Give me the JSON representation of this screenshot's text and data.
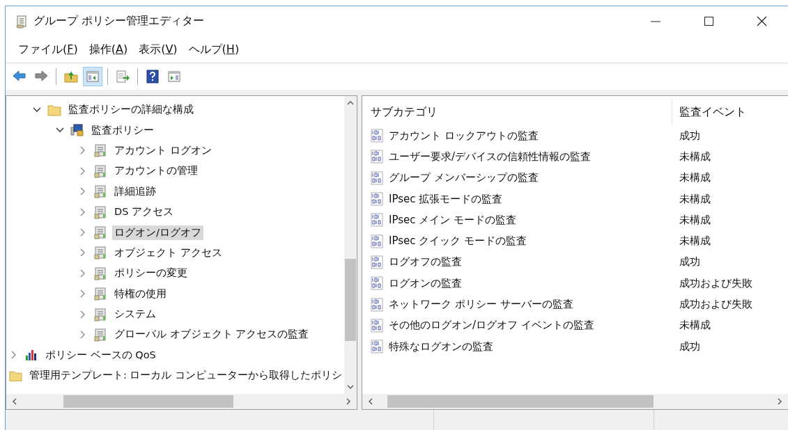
{
  "window": {
    "title": "グループ ポリシー管理エディター"
  },
  "menu": [
    {
      "label": "ファイル(",
      "access_key": "F",
      "label_end": ")"
    },
    {
      "label": "操作(",
      "access_key": "A",
      "label_end": ")"
    },
    {
      "label": "表示(",
      "access_key": "V",
      "label_end": ")"
    },
    {
      "label": "ヘルプ(",
      "access_key": "H",
      "label_end": ")"
    }
  ],
  "toolbar": [
    {
      "kind": "back",
      "pressed": false
    },
    {
      "kind": "forward",
      "pressed": false
    },
    {
      "kind": "separator"
    },
    {
      "kind": "up",
      "pressed": false
    },
    {
      "kind": "tree-toggle",
      "pressed": true
    },
    {
      "kind": "separator"
    },
    {
      "kind": "export",
      "pressed": false
    },
    {
      "kind": "separator"
    },
    {
      "kind": "help",
      "pressed": false
    },
    {
      "kind": "action-pane",
      "pressed": false
    }
  ],
  "tree": {
    "items": [
      {
        "kind": "offscreen-parent",
        "children": [
          {
            "kind": "folder",
            "label": "監査ポリシーの詳細な構成",
            "expanded": true,
            "selected": false,
            "children": [
              {
                "kind": "policy",
                "label": "監査ポリシー",
                "expanded": true,
                "selected": false,
                "children": [
                  {
                    "kind": "category",
                    "label": "アカウント ログオン",
                    "expanded": false,
                    "selected": false
                  },
                  {
                    "kind": "category",
                    "label": "アカウントの管理",
                    "expanded": false,
                    "selected": false
                  },
                  {
                    "kind": "category",
                    "label": "詳細追跡",
                    "expanded": false,
                    "selected": false
                  },
                  {
                    "kind": "category",
                    "label": "DS アクセス",
                    "expanded": false,
                    "selected": false
                  },
                  {
                    "kind": "category",
                    "label": "ログオン/ログオフ",
                    "expanded": false,
                    "selected": true
                  },
                  {
                    "kind": "category",
                    "label": "オブジェクト アクセス",
                    "expanded": false,
                    "selected": false
                  },
                  {
                    "kind": "category",
                    "label": "ポリシーの変更",
                    "expanded": false,
                    "selected": false
                  },
                  {
                    "kind": "category",
                    "label": "特権の使用",
                    "expanded": false,
                    "selected": false
                  },
                  {
                    "kind": "category",
                    "label": "システム",
                    "expanded": false,
                    "selected": false
                  },
                  {
                    "kind": "category",
                    "label": "グローバル オブジェクト アクセスの監査",
                    "expanded": false,
                    "selected": false
                  }
                ]
              }
            ]
          }
        ]
      },
      {
        "kind": "qos",
        "label": "ポリシー ベースの QoS",
        "expanded": false,
        "selected": false
      },
      {
        "kind": "folder",
        "label": "管理用テンプレート: ローカル コンピューターから取得したポリシ",
        "selected": false
      }
    ]
  },
  "list": {
    "columns": [
      "サブカテゴリ",
      "監査イベント"
    ],
    "rows": [
      {
        "subcategory": "アカウント ロックアウトの監査",
        "audit_event": "成功"
      },
      {
        "subcategory": "ユーザー要求/デバイスの信頼性情報の監査",
        "audit_event": "未構成"
      },
      {
        "subcategory": "グループ メンバーシップの監査",
        "audit_event": "未構成"
      },
      {
        "subcategory": "IPsec 拡張モードの監査",
        "audit_event": "未構成"
      },
      {
        "subcategory": "IPsec メイン モードの監査",
        "audit_event": "未構成"
      },
      {
        "subcategory": "IPsec クイック モードの監査",
        "audit_event": "未構成"
      },
      {
        "subcategory": "ログオフの監査",
        "audit_event": "成功"
      },
      {
        "subcategory": "ログオンの監査",
        "audit_event": "成功および失敗"
      },
      {
        "subcategory": "ネットワーク ポリシー サーバーの監査",
        "audit_event": "成功および失敗"
      },
      {
        "subcategory": "その他のログオン/ログオフ イベントの監査",
        "audit_event": "未構成"
      },
      {
        "subcategory": "特殊なログオンの監査",
        "audit_event": "成功"
      }
    ]
  }
}
